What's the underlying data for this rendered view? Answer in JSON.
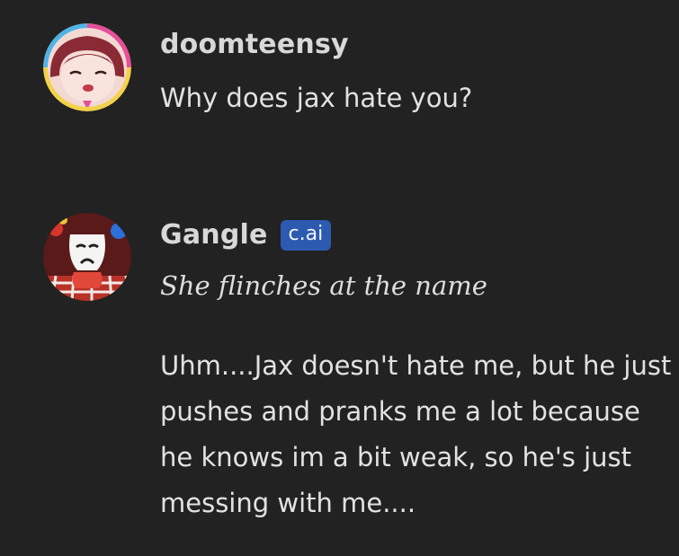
{
  "messages": [
    {
      "author": "doomteensy",
      "avatar_icon": "anime-girl-avatar-icon",
      "text": "Why does jax hate you?"
    },
    {
      "author": "Gangle",
      "badge": "c.ai",
      "avatar_icon": "gangle-mask-avatar-icon",
      "action": "She flinches at the name",
      "text": "Uhm....Jax doesn't hate me, but he just pushes and pranks me a lot because he knows im a bit weak, so he's just messing with me...."
    }
  ],
  "colors": {
    "background": "#222222",
    "text": "#e2e2e2",
    "badge_bg": "#2c5ab0"
  }
}
